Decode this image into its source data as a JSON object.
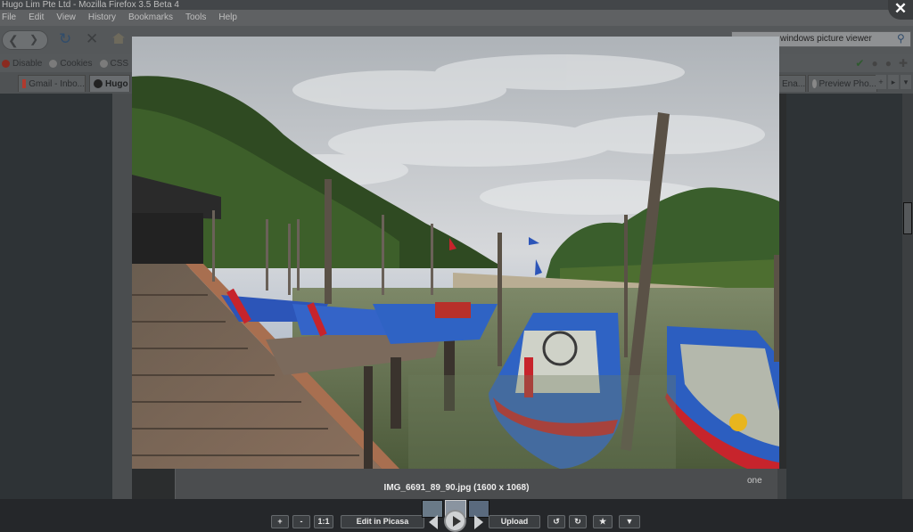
{
  "browser": {
    "title": "Hugo Lim Pte Ltd - Mozilla Firefox 3.5 Beta 4",
    "menu": [
      "File",
      "Edit",
      "View",
      "History",
      "Bookmarks",
      "Tools",
      "Help"
    ],
    "search_value": "windows picture viewer",
    "addons": [
      "Disable",
      "Cookies",
      "CSS"
    ],
    "tabs": [
      {
        "label": "Gmail - Inbo..."
      },
      {
        "label": "Hugo"
      },
      {
        "label": "Ena..."
      },
      {
        "label": "Preview Pho..."
      }
    ]
  },
  "page": {
    "side_text": "one"
  },
  "viewer": {
    "close_label": "✕",
    "caption": "IMG_6691_89_90.jpg (1600 x 1068)",
    "toolbar": {
      "zoom_in": "+",
      "zoom_out": "-",
      "actual_size": "1:1",
      "edit_in_picasa": "Edit in Picasa",
      "upload": "Upload",
      "rotate_left": "↺",
      "rotate_right": "↻",
      "star": "★",
      "more": "▼"
    }
  },
  "colors": {
    "overlay_bg": "#25272a",
    "sky": "#c9cdd3",
    "water": "#6b7a55",
    "boat_blue": "#2f63c4",
    "boat_red": "#c7242c"
  }
}
